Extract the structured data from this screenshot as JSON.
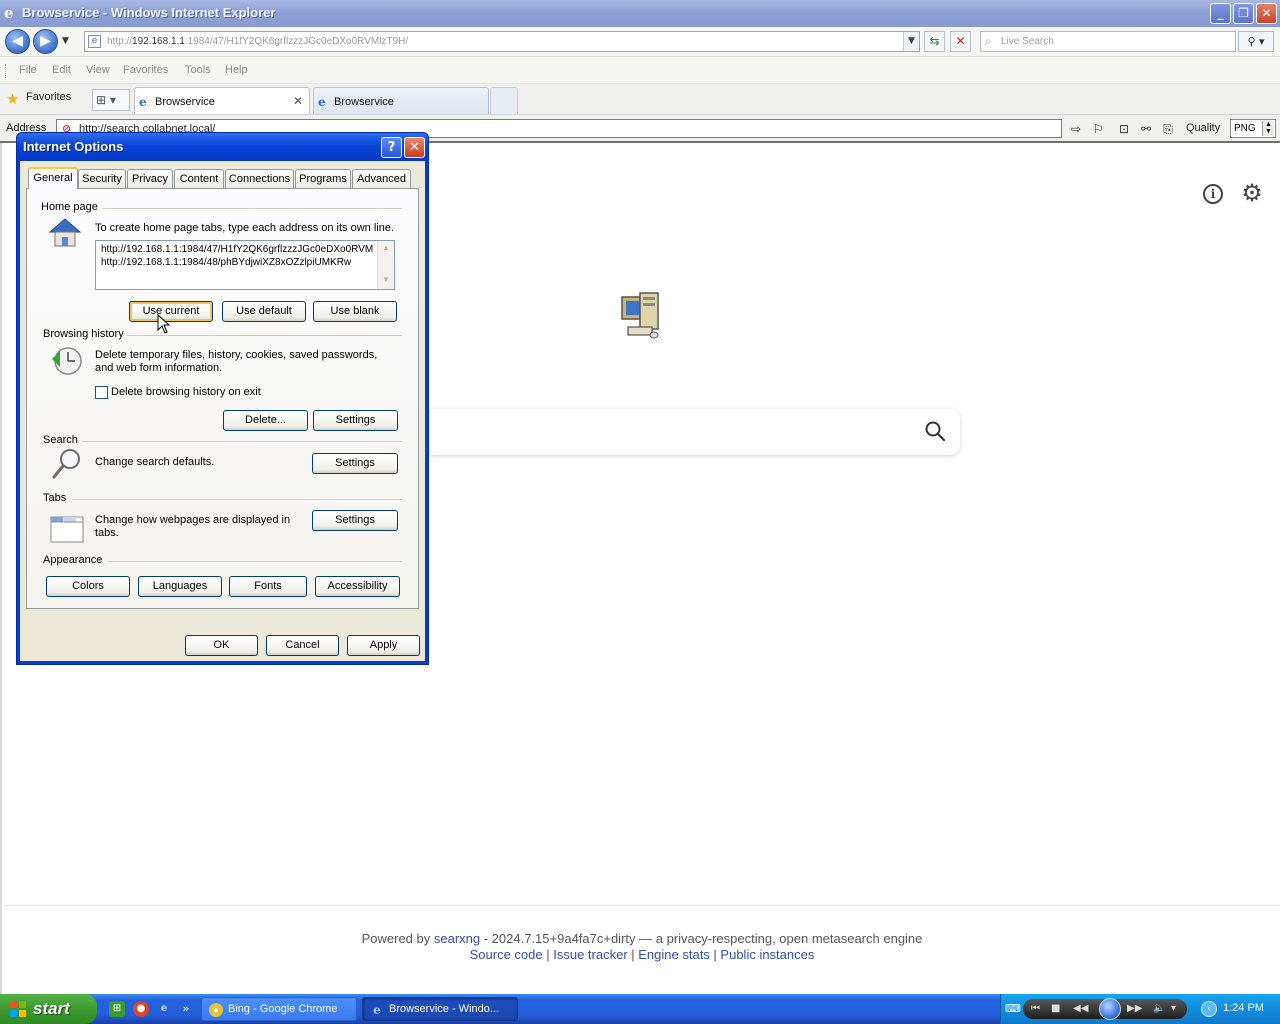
{
  "window": {
    "title": "Browservice - Windows Internet Explorer",
    "buttons": {
      "minimize": "_",
      "restore": "❐",
      "close": "✕"
    }
  },
  "navbar": {
    "url_prefix": "http://",
    "url_host": "192.168.1.1",
    "url_rest": ":1984/47/H1fY2QK6grflzzzJGc0eDXo0RVMlzT9H/",
    "search_placeholder": "Live Search"
  },
  "menubar": {
    "items": [
      "File",
      "Edit",
      "View",
      "Favorites",
      "Tools",
      "Help"
    ]
  },
  "favbar": {
    "favorites_label": "Favorites",
    "tabs": [
      {
        "label": "Browservice",
        "active": true
      },
      {
        "label": "Browservice",
        "active": false
      }
    ]
  },
  "addressbar": {
    "label": "Address",
    "value": "http://search.collabnet.local/",
    "quality_label": "Quality",
    "quality_value": "PNG"
  },
  "page": {
    "footer": {
      "powered_by": "Powered by",
      "engine_link": "searxng",
      "engine_desc": " - 2024.7.15+9a4fa7c+dirty — a privacy-respecting, open metasearch engine",
      "links": [
        "Source code",
        "Issue tracker",
        "Engine stats",
        "Public instances"
      ],
      "separator": " | "
    }
  },
  "dialog": {
    "title": "Internet Options",
    "tabs": [
      "General",
      "Security",
      "Privacy",
      "Content",
      "Connections",
      "Programs",
      "Advanced"
    ],
    "active_tab": "General",
    "home_page": {
      "group_title": "Home page",
      "instruction": "To create home page tabs, type each address on its own line.",
      "urls": [
        "http://192.168.1.1:1984/47/H1fY2QK6grflzzzJGc0eDXo0RVMlzT9H/",
        "http://192.168.1.1:1984/48/phBYdjwiXZ8xOZzlpiUMKRw"
      ],
      "use_current": "Use current",
      "use_default": "Use default",
      "use_blank": "Use blank"
    },
    "browsing_history": {
      "group_title": "Browsing history",
      "description": "Delete temporary files, history, cookies, saved passwords, and web form information.",
      "delete_on_exit_label": "Delete browsing history on exit",
      "delete_on_exit_checked": false,
      "delete_button": "Delete...",
      "settings_button": "Settings"
    },
    "search": {
      "group_title": "Search",
      "description": "Change search defaults.",
      "settings_button": "Settings"
    },
    "tabs_group": {
      "group_title": "Tabs",
      "description": "Change how webpages are displayed in tabs.",
      "settings_button": "Settings"
    },
    "appearance": {
      "group_title": "Appearance",
      "buttons": [
        "Colors",
        "Languages",
        "Fonts",
        "Accessibility"
      ]
    },
    "footer_buttons": {
      "ok": "OK",
      "cancel": "Cancel",
      "apply": "Apply"
    }
  },
  "taskbar": {
    "start_label": "start",
    "tasks": [
      {
        "label": "Bing - Google Chrome",
        "active": false
      },
      {
        "label": "Browservice - Windo...",
        "active": true
      }
    ],
    "clock": "1:24 PM"
  },
  "colors": {
    "xp_blue": "#0a44d8",
    "start_green": "#3c9b2f",
    "link_blue": "#3050a8"
  }
}
